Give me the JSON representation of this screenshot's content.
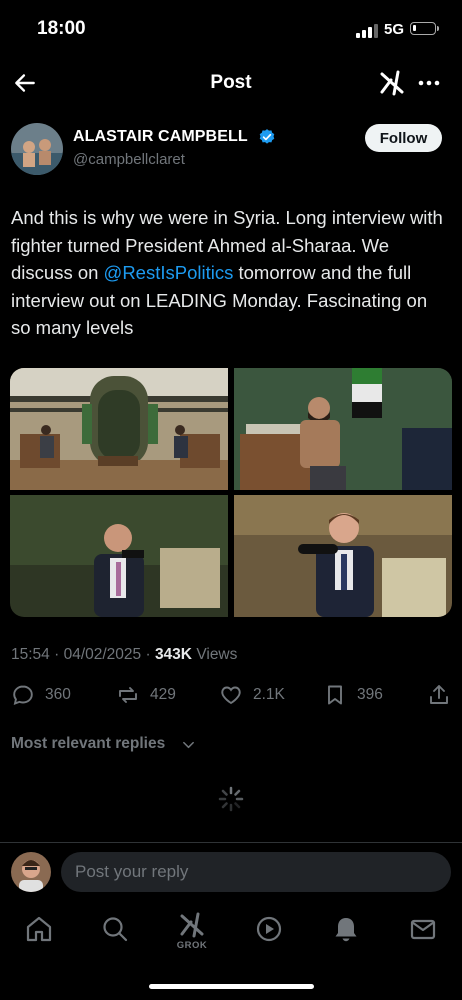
{
  "status_bar": {
    "time": "18:00",
    "network": "5G"
  },
  "header": {
    "title": "Post"
  },
  "author": {
    "name": "ALASTAIR CAMPBELL",
    "handle": "@campbellclaret",
    "follow_label": "Follow",
    "verified_color": "#1d9bf0"
  },
  "tweet": {
    "text_before": "And this is why we were in Syria. Long interview with fighter turned President Ahmed al-Sharaa. We discuss on ",
    "mention": "@RestIsPolitics",
    "text_after": " tomorrow and the full interview out on LEADING Monday. Fascinating on so many levels",
    "media_count": 4
  },
  "meta": {
    "time": "15:54",
    "date": "04/02/2025",
    "views_count": "343K",
    "views_label": "Views"
  },
  "actions": {
    "replies": "360",
    "reposts": "429",
    "likes": "2.1K",
    "bookmarks": "396"
  },
  "replies_section": {
    "sort_label": "Most relevant replies"
  },
  "composer": {
    "placeholder": "Post your reply"
  },
  "bottom_nav": {
    "items": [
      "home-icon",
      "search-icon",
      "grok-icon",
      "video-icon",
      "notifications-icon",
      "messages-icon"
    ],
    "grok_label": "GROK"
  },
  "colors": {
    "background": "#000000",
    "link": "#1d9bf0",
    "muted": "#71767b",
    "text": "#e7e9ea"
  }
}
